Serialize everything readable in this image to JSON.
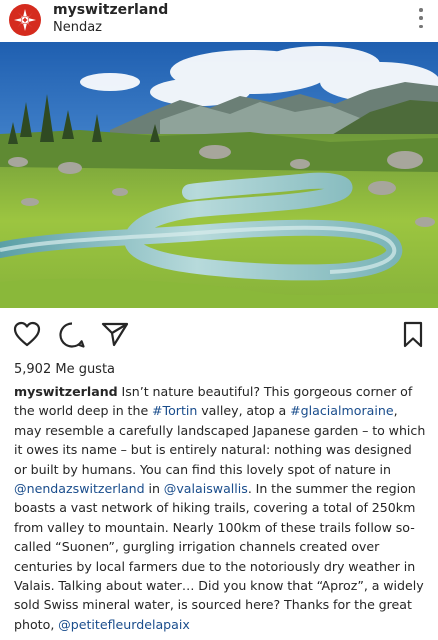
{
  "post": {
    "username": "myswitzerland",
    "location": "Nendaz",
    "likes": "5,902 Me gusta",
    "caption_text_1": "Isn’t nature beautiful? This gorgeous corner of the world deep in the ",
    "tag_1": "#Tortin",
    "caption_text_2": " valley, atop a ",
    "tag_2": "#glacialmoraine",
    "caption_text_3": ", may resemble a carefully landscaped Japanese garden – to which it owes its name – but is entirely natural: nothing was designed or built by humans. You can find this lovely spot of nature in ",
    "tag_3": "@nendazswitzerland",
    "caption_text_4": " in ",
    "tag_4": "@valaiswallis",
    "caption_text_5": ". In the summer the region boasts a vast network of hiking trails, covering a total of 250km from valley to mountain. Nearly 100km of these trails follow so-called “Suonen”, gurgling irrigation channels created over centuries by local farmers due to the notoriously dry weather in Valais. Talking about water… Did you know that “Aproz”, a widely sold Swiss mineral water, is sourced here? Thanks for the great photo, ",
    "tag_5": "@petitefleurdelapaix"
  },
  "icons": {
    "avatar": "switzerland-star-logo",
    "more": "more-options-icon",
    "like": "heart-icon",
    "comment": "comment-icon",
    "share": "send-icon",
    "save": "bookmark-icon"
  },
  "colors": {
    "brand_red": "#d52b1e",
    "link": "#1a4d8c",
    "text": "#262626"
  }
}
